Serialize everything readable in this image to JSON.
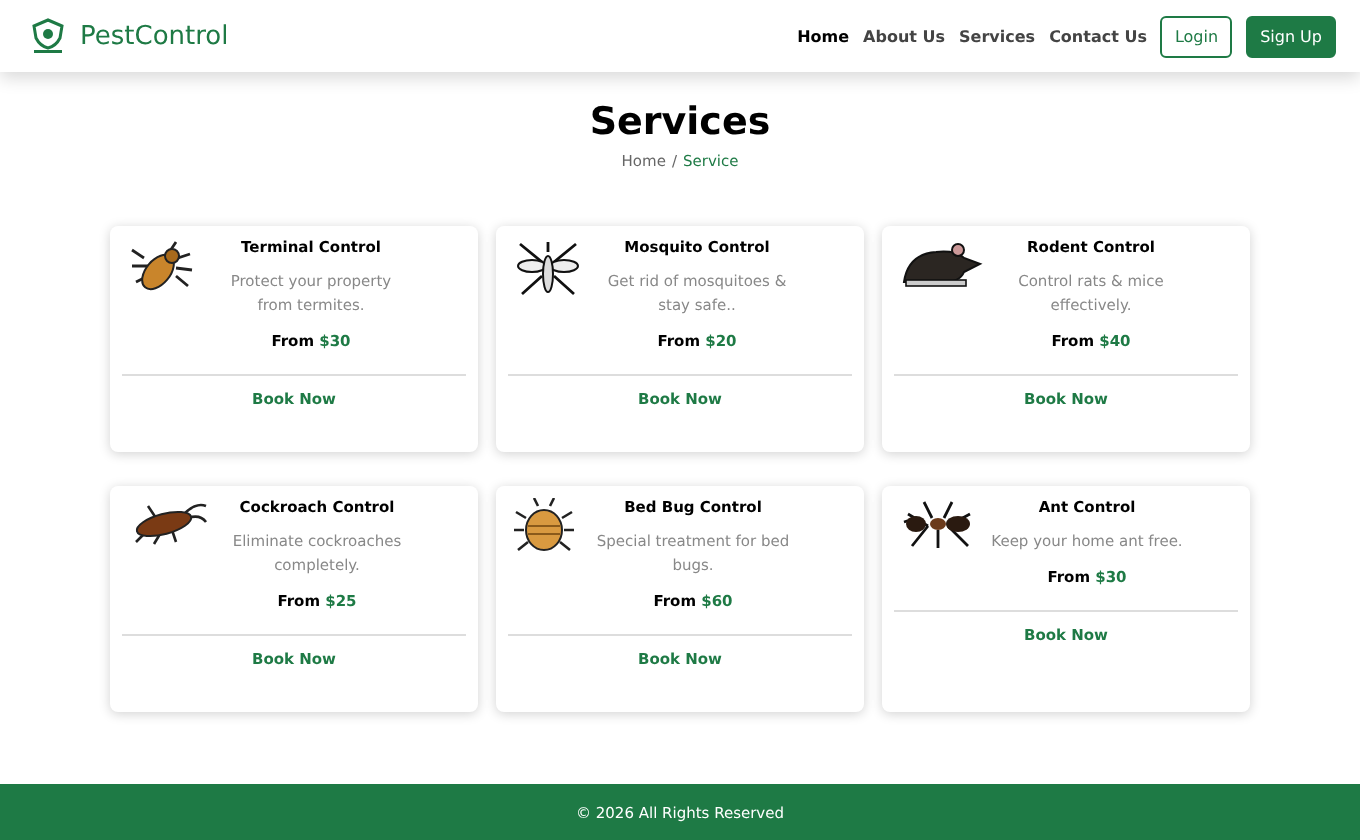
{
  "brand": {
    "name": "PestControl"
  },
  "nav": [
    {
      "label": "Home",
      "selected": true
    },
    {
      "label": "About Us",
      "selected": false
    },
    {
      "label": "Services",
      "selected": false
    },
    {
      "label": "Contact Us",
      "selected": false
    }
  ],
  "auth": {
    "login": "Login",
    "signup": "Sign Up"
  },
  "page": {
    "title": "Services",
    "breadcrumb": [
      "Home",
      "Service"
    ],
    "separator": "/"
  },
  "services": [
    {
      "title": "Terminal Control",
      "description": "Protect your property from termites.",
      "price_prefix": "From",
      "price": "$30",
      "action": "Book Now"
    },
    {
      "title": "Mosquito Control",
      "description": "Get rid of mosquitoes & stay safe..",
      "price_prefix": "From",
      "price": "$20",
      "action": "Book Now"
    },
    {
      "title": "Rodent Control",
      "description": "Control rats & mice effectively.",
      "price_prefix": "From",
      "price": "$40",
      "action": "Book Now"
    },
    {
      "title": "Cockroach Control",
      "description": "Eliminate cockroaches completely.",
      "price_prefix": "From",
      "price": "$25",
      "action": "Book Now"
    },
    {
      "title": "Bed Bug Control",
      "description": "Special treatment for bed bugs.",
      "price_prefix": "From",
      "price": "$60",
      "action": "Book Now"
    },
    {
      "title": "Ant Control",
      "description": "Keep your home ant free.",
      "price_prefix": "From",
      "price": "$30",
      "action": "Book Now"
    }
  ],
  "footer": {
    "text": "© 2026 All Rights Reserved"
  }
}
